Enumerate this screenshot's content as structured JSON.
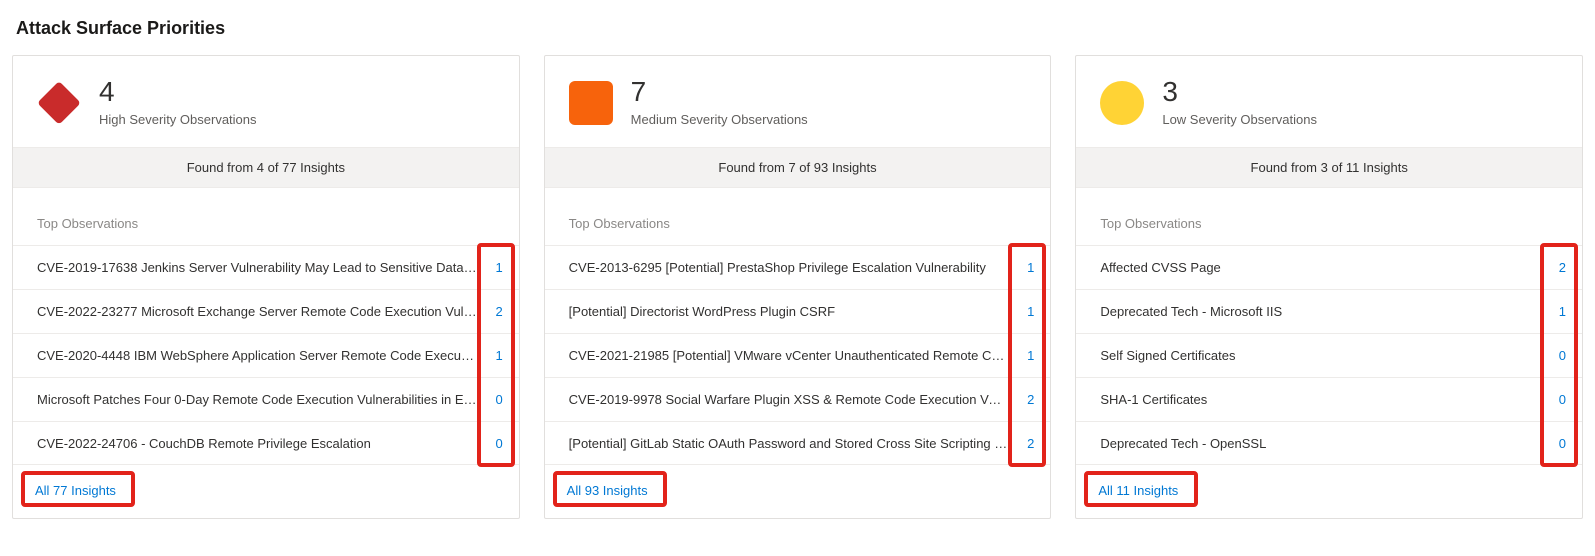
{
  "pageTitle": "Attack Surface Priorities",
  "cards": [
    {
      "severity": "high",
      "count": "4",
      "subtitle": "High Severity Observations",
      "foundLine": "Found from 4 of 77 Insights",
      "topLabel": "Top Observations",
      "allLink": "All 77 Insights",
      "observations": [
        {
          "title": "CVE-2019-17638 Jenkins Server Vulnerability May Lead to Sensitive Data L…",
          "count": "1"
        },
        {
          "title": "CVE-2022-23277 Microsoft Exchange Server Remote Code Execution Vuln…",
          "count": "2"
        },
        {
          "title": "CVE-2020-4448 IBM WebSphere Application Server Remote Code Executi…",
          "count": "1"
        },
        {
          "title": "Microsoft Patches Four 0-Day Remote Code Execution Vulnerabilities in Ex…",
          "count": "0"
        },
        {
          "title": "CVE-2022-24706 - CouchDB Remote Privilege Escalation",
          "count": "0"
        }
      ]
    },
    {
      "severity": "medium",
      "count": "7",
      "subtitle": "Medium Severity Observations",
      "foundLine": "Found from 7 of 93 Insights",
      "topLabel": "Top Observations",
      "allLink": "All 93 Insights",
      "observations": [
        {
          "title": "CVE-2013-6295 [Potential] PrestaShop Privilege Escalation Vulnerability",
          "count": "1"
        },
        {
          "title": "[Potential] Directorist WordPress Plugin CSRF",
          "count": "1"
        },
        {
          "title": "CVE-2021-21985 [Potential] VMware vCenter Unauthenticated Remote Co…",
          "count": "1"
        },
        {
          "title": "CVE-2019-9978 Social Warfare Plugin XSS & Remote Code Execution Vuln…",
          "count": "2"
        },
        {
          "title": "[Potential] GitLab Static OAuth Password and Stored Cross Site Scripting (X…",
          "count": "2"
        }
      ]
    },
    {
      "severity": "low",
      "count": "3",
      "subtitle": "Low Severity Observations",
      "foundLine": "Found from 3 of 11 Insights",
      "topLabel": "Top Observations",
      "allLink": "All 11 Insights",
      "observations": [
        {
          "title": "Affected CVSS Page",
          "count": "2"
        },
        {
          "title": "Deprecated Tech - Microsoft IIS",
          "count": "1"
        },
        {
          "title": "Self Signed Certificates",
          "count": "0"
        },
        {
          "title": "SHA-1 Certificates",
          "count": "0"
        },
        {
          "title": "Deprecated Tech - OpenSSL",
          "count": "0"
        }
      ]
    }
  ]
}
